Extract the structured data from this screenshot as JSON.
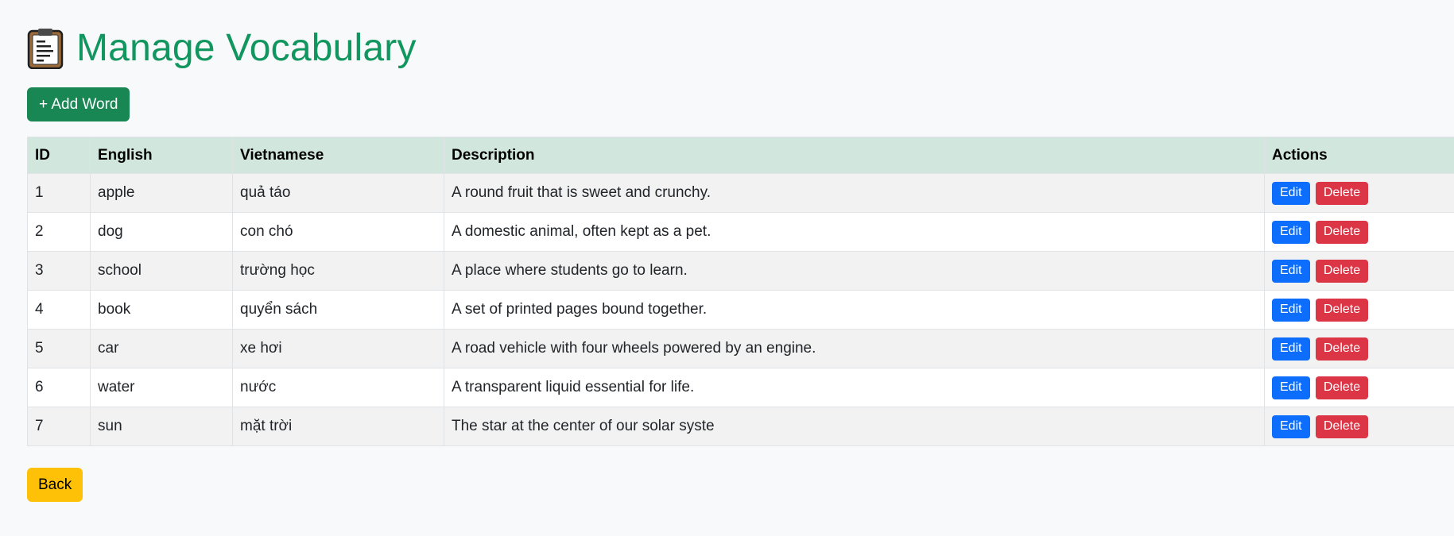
{
  "header": {
    "icon": "clipboard-icon",
    "title": "Manage Vocabulary",
    "title_color": "#12965f"
  },
  "toolbar": {
    "add_label": "+ Add Word"
  },
  "table": {
    "columns": [
      "ID",
      "English",
      "Vietnamese",
      "Description",
      "Actions"
    ],
    "rows": [
      {
        "id": "1",
        "english": "apple",
        "vietnamese": "quả táo",
        "description": "A round fruit that is sweet and crunchy.",
        "edit": "Edit",
        "delete": "Delete"
      },
      {
        "id": "2",
        "english": "dog",
        "vietnamese": "con chó",
        "description": "A domestic animal, often kept as a pet.",
        "edit": "Edit",
        "delete": "Delete"
      },
      {
        "id": "3",
        "english": "school",
        "vietnamese": "trường học",
        "description": "A place where students go to learn.",
        "edit": "Edit",
        "delete": "Delete"
      },
      {
        "id": "4",
        "english": "book",
        "vietnamese": "quyển sách",
        "description": "A set of printed pages bound together.",
        "edit": "Edit",
        "delete": "Delete"
      },
      {
        "id": "5",
        "english": "car",
        "vietnamese": "xe hơi",
        "description": "A road vehicle with four wheels powered by an engine.",
        "edit": "Edit",
        "delete": "Delete"
      },
      {
        "id": "6",
        "english": "water",
        "vietnamese": "nước",
        "description": "A transparent liquid essential for life.",
        "edit": "Edit",
        "delete": "Delete"
      },
      {
        "id": "7",
        "english": "sun",
        "vietnamese": "mặt trời",
        "description": "The star at the center of our solar syste",
        "edit": "Edit",
        "delete": "Delete"
      }
    ]
  },
  "footer": {
    "back_label": "Back"
  },
  "colors": {
    "add_button": "#198754",
    "header_bg": "#d1e7dd",
    "edit_button": "#0d6efd",
    "delete_button": "#dc3545",
    "back_button": "#ffc107"
  }
}
